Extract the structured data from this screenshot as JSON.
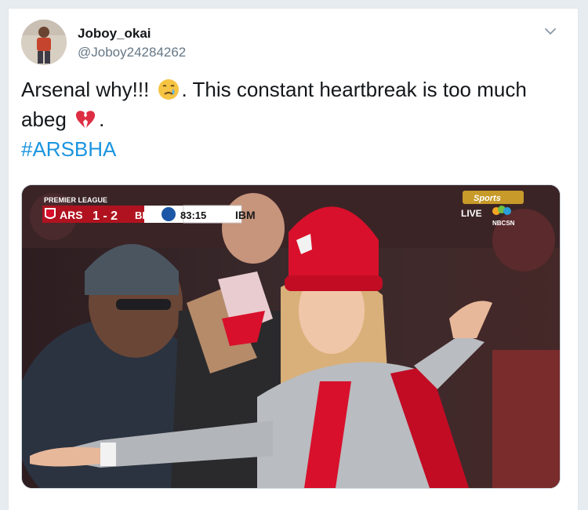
{
  "tweet": {
    "display_name": "Joboy_okai",
    "handle": "@Joboy24284262",
    "text_part1": "Arsenal why!!! ",
    "text_part2": ". This constant heartbreak is too much abeg ",
    "text_part3": ".",
    "hashtag": "#ARSBHA",
    "icons": [
      "crying-face-emoji",
      "broken-heart-emoji",
      "chevron-down-icon"
    ]
  },
  "broadcast": {
    "league": "PREMIER LEAGUE",
    "home_team": "ARS",
    "score": "1 - 2",
    "away_team": "BHA",
    "clock": "83:15",
    "sponsor": "IBM",
    "network": "Sports",
    "live": "LIVE",
    "channel": "NBCSN"
  },
  "colors": {
    "link": "#1b95e0",
    "arsenal_red": "#d8102b",
    "text": "#14171a",
    "muted": "#657786"
  }
}
